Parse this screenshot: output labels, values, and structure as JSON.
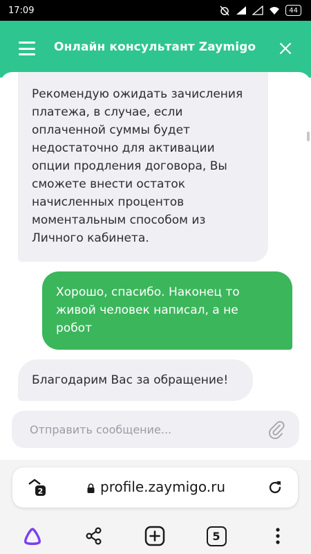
{
  "status_bar": {
    "time": "17:09",
    "battery": "44"
  },
  "header": {
    "title": "Онлайн консультант Zaymigo"
  },
  "messages": [
    {
      "sender": "operator",
      "lines": [
        "Рекомендую ожидать зачисления",
        "платежа, в случае, если",
        "оплаченной суммы будет",
        "недостаточно для активации",
        "опции продления договора, Вы",
        "сможете внести остаток",
        "начисленных процентов",
        "моментальным способом из",
        "Личного кабинета."
      ]
    },
    {
      "sender": "user",
      "lines": [
        "Хорошо, спасибо. Наконец то",
        "живой человек написал, а не",
        "робот"
      ]
    },
    {
      "sender": "operator",
      "lines": [
        "Благодарим Вас за обращение!"
      ]
    }
  ],
  "composer": {
    "placeholder": "Отправить сообщение..."
  },
  "browser": {
    "url": "profile.zaymigo.ru",
    "tab_badge": "2",
    "tabs_count": "5"
  },
  "colors": {
    "header": "#2ec591",
    "user_bubble": "#3bb65b",
    "operator_bubble": "#f0f0f4",
    "alice_accent": "#7b3ff2"
  }
}
